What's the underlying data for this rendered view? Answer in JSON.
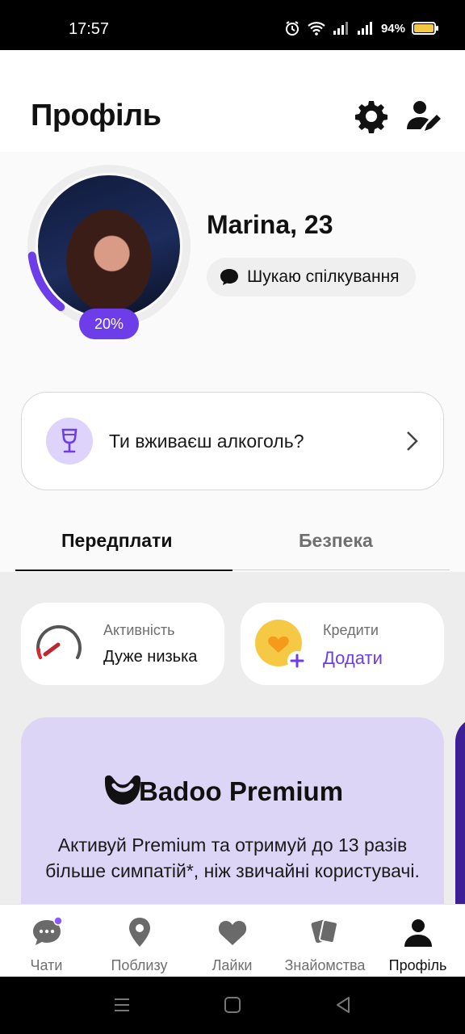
{
  "status_bar": {
    "time": "17:57",
    "battery": "94%"
  },
  "header": {
    "title": "Профіль"
  },
  "profile": {
    "name": "Marina, 23",
    "completion": "20%",
    "completion_value": 0.2,
    "intent": "Шукаю спілкування"
  },
  "question_card": {
    "text": "Ти вживаєш алкоголь?"
  },
  "tabs": [
    {
      "label": "Передплати",
      "active": true
    },
    {
      "label": "Безпека",
      "active": false
    }
  ],
  "activity": {
    "label": "Активність",
    "value": "Дуже низька"
  },
  "credits": {
    "label": "Кредити",
    "action": "Додати"
  },
  "premium": {
    "title": "Badoo Premium",
    "description": "Активуй Premium та отримуй до 13 разів більше симпатій*, ніж звичайні користувачі."
  },
  "nav": [
    {
      "label": "Чати",
      "icon": "chat-icon"
    },
    {
      "label": "Поблизу",
      "icon": "location-pin-icon"
    },
    {
      "label": "Лайки",
      "icon": "heart-icon"
    },
    {
      "label": "Знайомства",
      "icon": "cards-icon"
    },
    {
      "label": "Профіль",
      "icon": "person-icon",
      "active": true
    }
  ],
  "colors": {
    "accent": "#6c3de8",
    "premium_bg": "#ddd5f5",
    "credits_coin": "#f6c945"
  }
}
